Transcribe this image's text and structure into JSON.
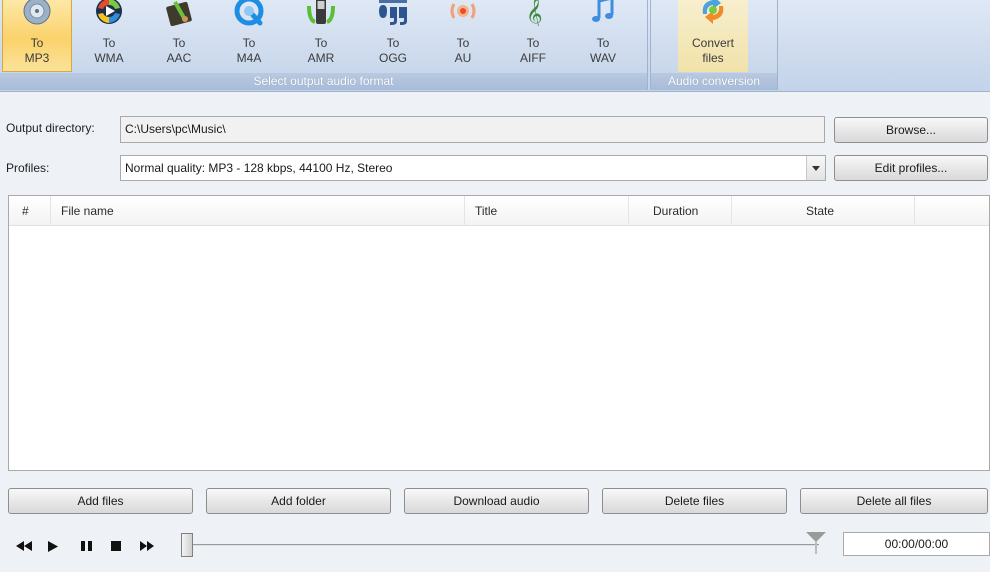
{
  "ribbon": {
    "formats": [
      {
        "line1": "To",
        "line2": "MP3",
        "icon": "mp3-disc-icon",
        "active": true
      },
      {
        "line1": "To",
        "line2": "WMA",
        "icon": "wma-play-icon",
        "active": false
      },
      {
        "line1": "To",
        "line2": "AAC",
        "icon": "aac-icon",
        "active": false
      },
      {
        "line1": "To",
        "line2": "M4A",
        "icon": "m4a-quicktime-icon",
        "active": false
      },
      {
        "line1": "To",
        "line2": "AMR",
        "icon": "amr-phone-icon",
        "active": false
      },
      {
        "line1": "To",
        "line2": "OGG",
        "icon": "ogg-logo-icon",
        "active": false
      },
      {
        "line1": "To",
        "line2": "AU",
        "icon": "au-speaker-icon",
        "active": false
      },
      {
        "line1": "To",
        "line2": "AIFF",
        "icon": "aiff-treble-clef-icon",
        "active": false
      },
      {
        "line1": "To",
        "line2": "WAV",
        "icon": "wav-note-icon",
        "active": false
      }
    ],
    "formats_group_label": "Select output audio format",
    "convert": {
      "line1": "Convert",
      "line2": "files",
      "icon": "convert-files-icon"
    },
    "conversion_group_label": "Audio conversion"
  },
  "output": {
    "label": "Output directory:",
    "value": "C:\\Users\\pc\\Music\\",
    "browse": "Browse..."
  },
  "profiles": {
    "label": "Profiles:",
    "selected": "Normal quality: MP3 - 128 kbps, 44100 Hz, Stereo",
    "edit": "Edit profiles..."
  },
  "table": {
    "columns": [
      "#",
      "File name",
      "Title",
      "Duration",
      "State"
    ],
    "rows": []
  },
  "actions": {
    "add_files": "Add files",
    "add_folder": "Add folder",
    "download_audio": "Download audio",
    "delete_files": "Delete files",
    "delete_all": "Delete all files"
  },
  "player": {
    "time": "00:00/00:00",
    "position": 0,
    "controls": [
      "rewind-icon",
      "play-icon",
      "pause-icon",
      "stop-icon",
      "fast-forward-icon"
    ]
  },
  "colors": {
    "ribbon_bg": "#cbd9ec",
    "active_button": "#fbd26b",
    "group_label": "#a8bcd8"
  }
}
